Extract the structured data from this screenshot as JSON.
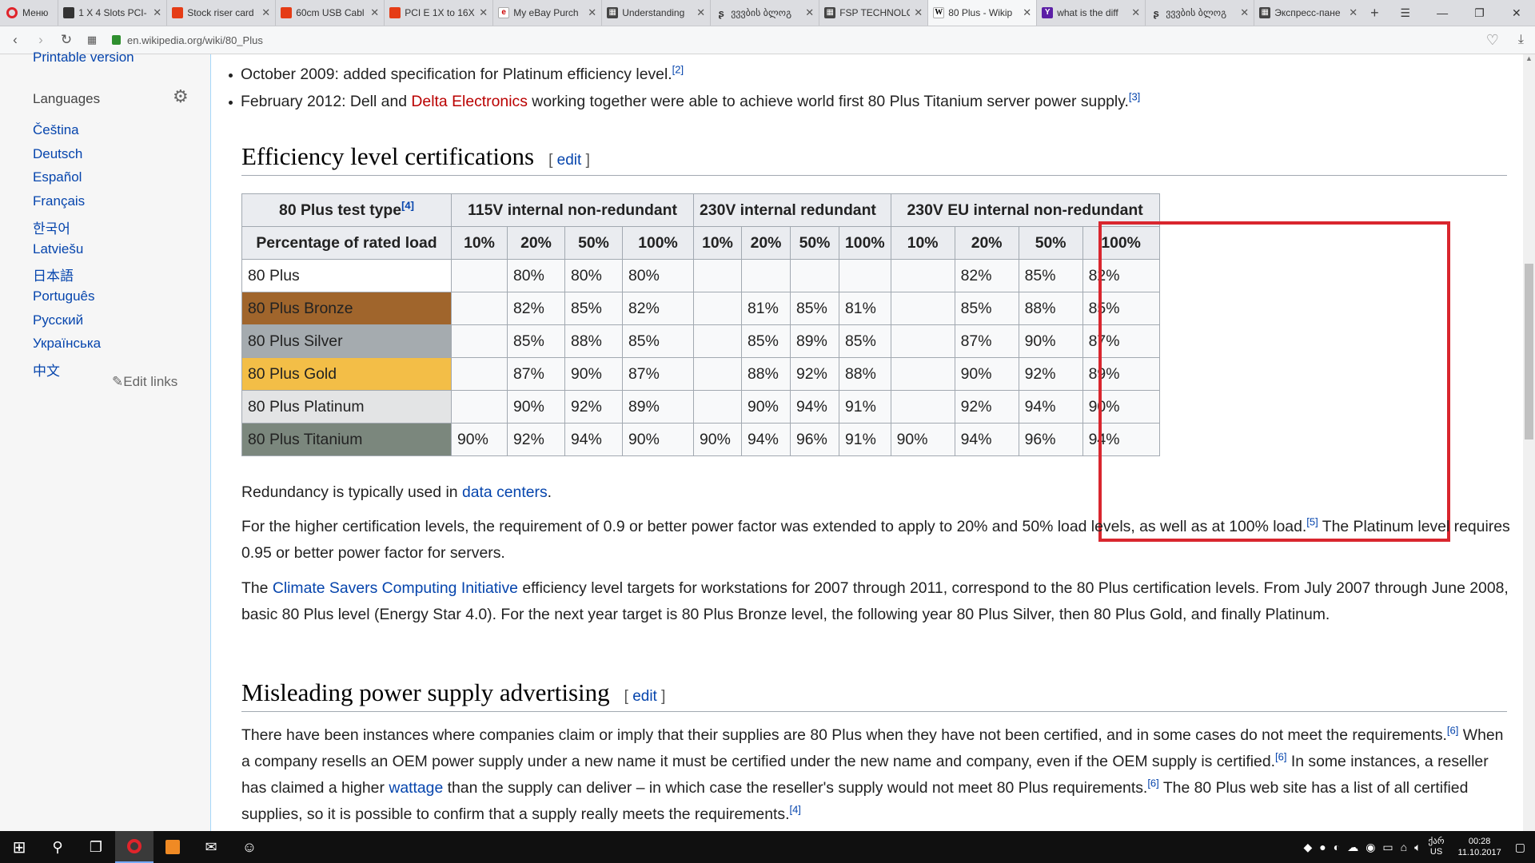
{
  "browser": {
    "menu_label": "Меню",
    "tabs": [
      {
        "title": "1 X 4 Slots PCI-",
        "icon": "film"
      },
      {
        "title": "Stock riser card",
        "icon": "red"
      },
      {
        "title": "60cm USB Cabl",
        "icon": "red"
      },
      {
        "title": "PCI E 1X to 16X",
        "icon": "red"
      },
      {
        "title": "My eBay Purch",
        "icon": "ebay"
      },
      {
        "title": "Understanding",
        "icon": "speed"
      },
      {
        "title": "ვვვბის ბლოგ",
        "icon": "geo"
      },
      {
        "title": "FSP TECHNOLO",
        "icon": "speed"
      },
      {
        "title": "80 Plus - Wikip",
        "icon": "wiki",
        "active": true
      },
      {
        "title": "what is the diff",
        "icon": "yahoo"
      },
      {
        "title": "ვვვბის ბლოგ",
        "icon": "geo"
      },
      {
        "title": "Экспресс-пане",
        "icon": "speed"
      }
    ],
    "url": "en.wikipedia.org/wiki/80_Plus"
  },
  "sidebar": {
    "printable": "Printable version",
    "languages_heading": "Languages",
    "languages": [
      "Čeština",
      "Deutsch",
      "Español",
      "Français",
      "한국어",
      "Latviešu",
      "日本語",
      "Português",
      "Русский",
      "Українська",
      "中文"
    ],
    "edit_links": "Edit links"
  },
  "content": {
    "bullet1": {
      "text": "October 2009: added specification for Platinum efficiency level.",
      "ref": "[2]"
    },
    "bullet2": {
      "pre": "February 2012: Dell and ",
      "link": "Delta Electronics",
      "post": " working together were able to achieve world first 80 Plus Titanium server power supply.",
      "ref": "[3]"
    },
    "section1": {
      "title": "Efficiency level certifications",
      "edit": "edit"
    },
    "table": {
      "header_test_type": "80 Plus test type",
      "header_test_ref": "[4]",
      "groups": [
        "115V internal non-redundant",
        "230V internal redundant",
        "230V EU internal non-redundant"
      ],
      "load_label": "Percentage of rated load",
      "loads": [
        "10%",
        "20%",
        "50%",
        "100%"
      ],
      "rows": [
        {
          "name": "80 Plus",
          "color": "#ffffff",
          "values": [
            "",
            "80%",
            "80%",
            "80%",
            "",
            "",
            "",
            "",
            "",
            "82%",
            "85%",
            "82%"
          ]
        },
        {
          "name": "80 Plus Bronze",
          "color": "#a0652c",
          "values": [
            "",
            "82%",
            "85%",
            "82%",
            "",
            "81%",
            "85%",
            "81%",
            "",
            "85%",
            "88%",
            "85%"
          ]
        },
        {
          "name": "80 Plus Silver",
          "color": "#a5abaf",
          "values": [
            "",
            "85%",
            "88%",
            "85%",
            "",
            "85%",
            "89%",
            "85%",
            "",
            "87%",
            "90%",
            "87%"
          ]
        },
        {
          "name": "80 Plus Gold",
          "color": "#f3be47",
          "values": [
            "",
            "87%",
            "90%",
            "87%",
            "",
            "88%",
            "92%",
            "88%",
            "",
            "90%",
            "92%",
            "89%"
          ]
        },
        {
          "name": "80 Plus Platinum",
          "color": "#e3e4e5",
          "values": [
            "",
            "90%",
            "92%",
            "89%",
            "",
            "90%",
            "94%",
            "91%",
            "",
            "92%",
            "94%",
            "90%"
          ]
        },
        {
          "name": "80 Plus Titanium",
          "color": "#7b877d",
          "values": [
            "90%",
            "92%",
            "94%",
            "90%",
            "90%",
            "94%",
            "96%",
            "91%",
            "90%",
            "94%",
            "96%",
            "94%"
          ]
        }
      ]
    },
    "redundancy": {
      "pre": "Redundancy is typically used in ",
      "link": "data centers",
      "post": "."
    },
    "para_pf": {
      "text1": "For the higher certification levels, the requirement of 0.9 or better power factor was extended to apply to 20% and 50% load levels, as well as at 100% load.",
      "ref": "[5]",
      "text2": " The Platinum level requires 0.95 or better power factor for servers."
    },
    "para_cs": {
      "pre": "The ",
      "link": "Climate Savers Computing Initiative",
      "post": " efficiency level targets for workstations for 2007 through 2011, correspond to the 80 Plus certification levels. From July 2007 through June 2008, basic 80 Plus level (Energy Star 4.0). For the next year target is 80 Plus Bronze level, the following year 80 Plus Silver, then 80 Plus Gold, and finally Platinum."
    },
    "section2": {
      "title": "Misleading power supply advertising",
      "edit": "edit"
    },
    "para_mis": {
      "t1": "There have been instances where companies claim or imply that their supplies are 80 Plus when they have not been certified, and in some cases do not meet the requirements.",
      "r1": "[6]",
      "t2": " When a company resells an OEM power supply under a new name it must be certified under the new name and company, even if the OEM supply is certified.",
      "r2": "[6]",
      "t3": " In some instances, a reseller has claimed a higher ",
      "link": "wattage",
      "t4": " than the supply can deliver – in which case the reseller's supply would not meet 80 Plus requirements.",
      "r3": "[6]",
      "t5": " The 80 Plus web site has a list of all certified supplies, so it is possible to confirm that a supply really meets the requirements.",
      "r4": "[4]"
    },
    "highlight_color": "#d9262e"
  },
  "taskbar": {
    "lang_top": "ქარ",
    "lang_bottom": "US",
    "time": "00:28",
    "date": "11.10.2017"
  }
}
